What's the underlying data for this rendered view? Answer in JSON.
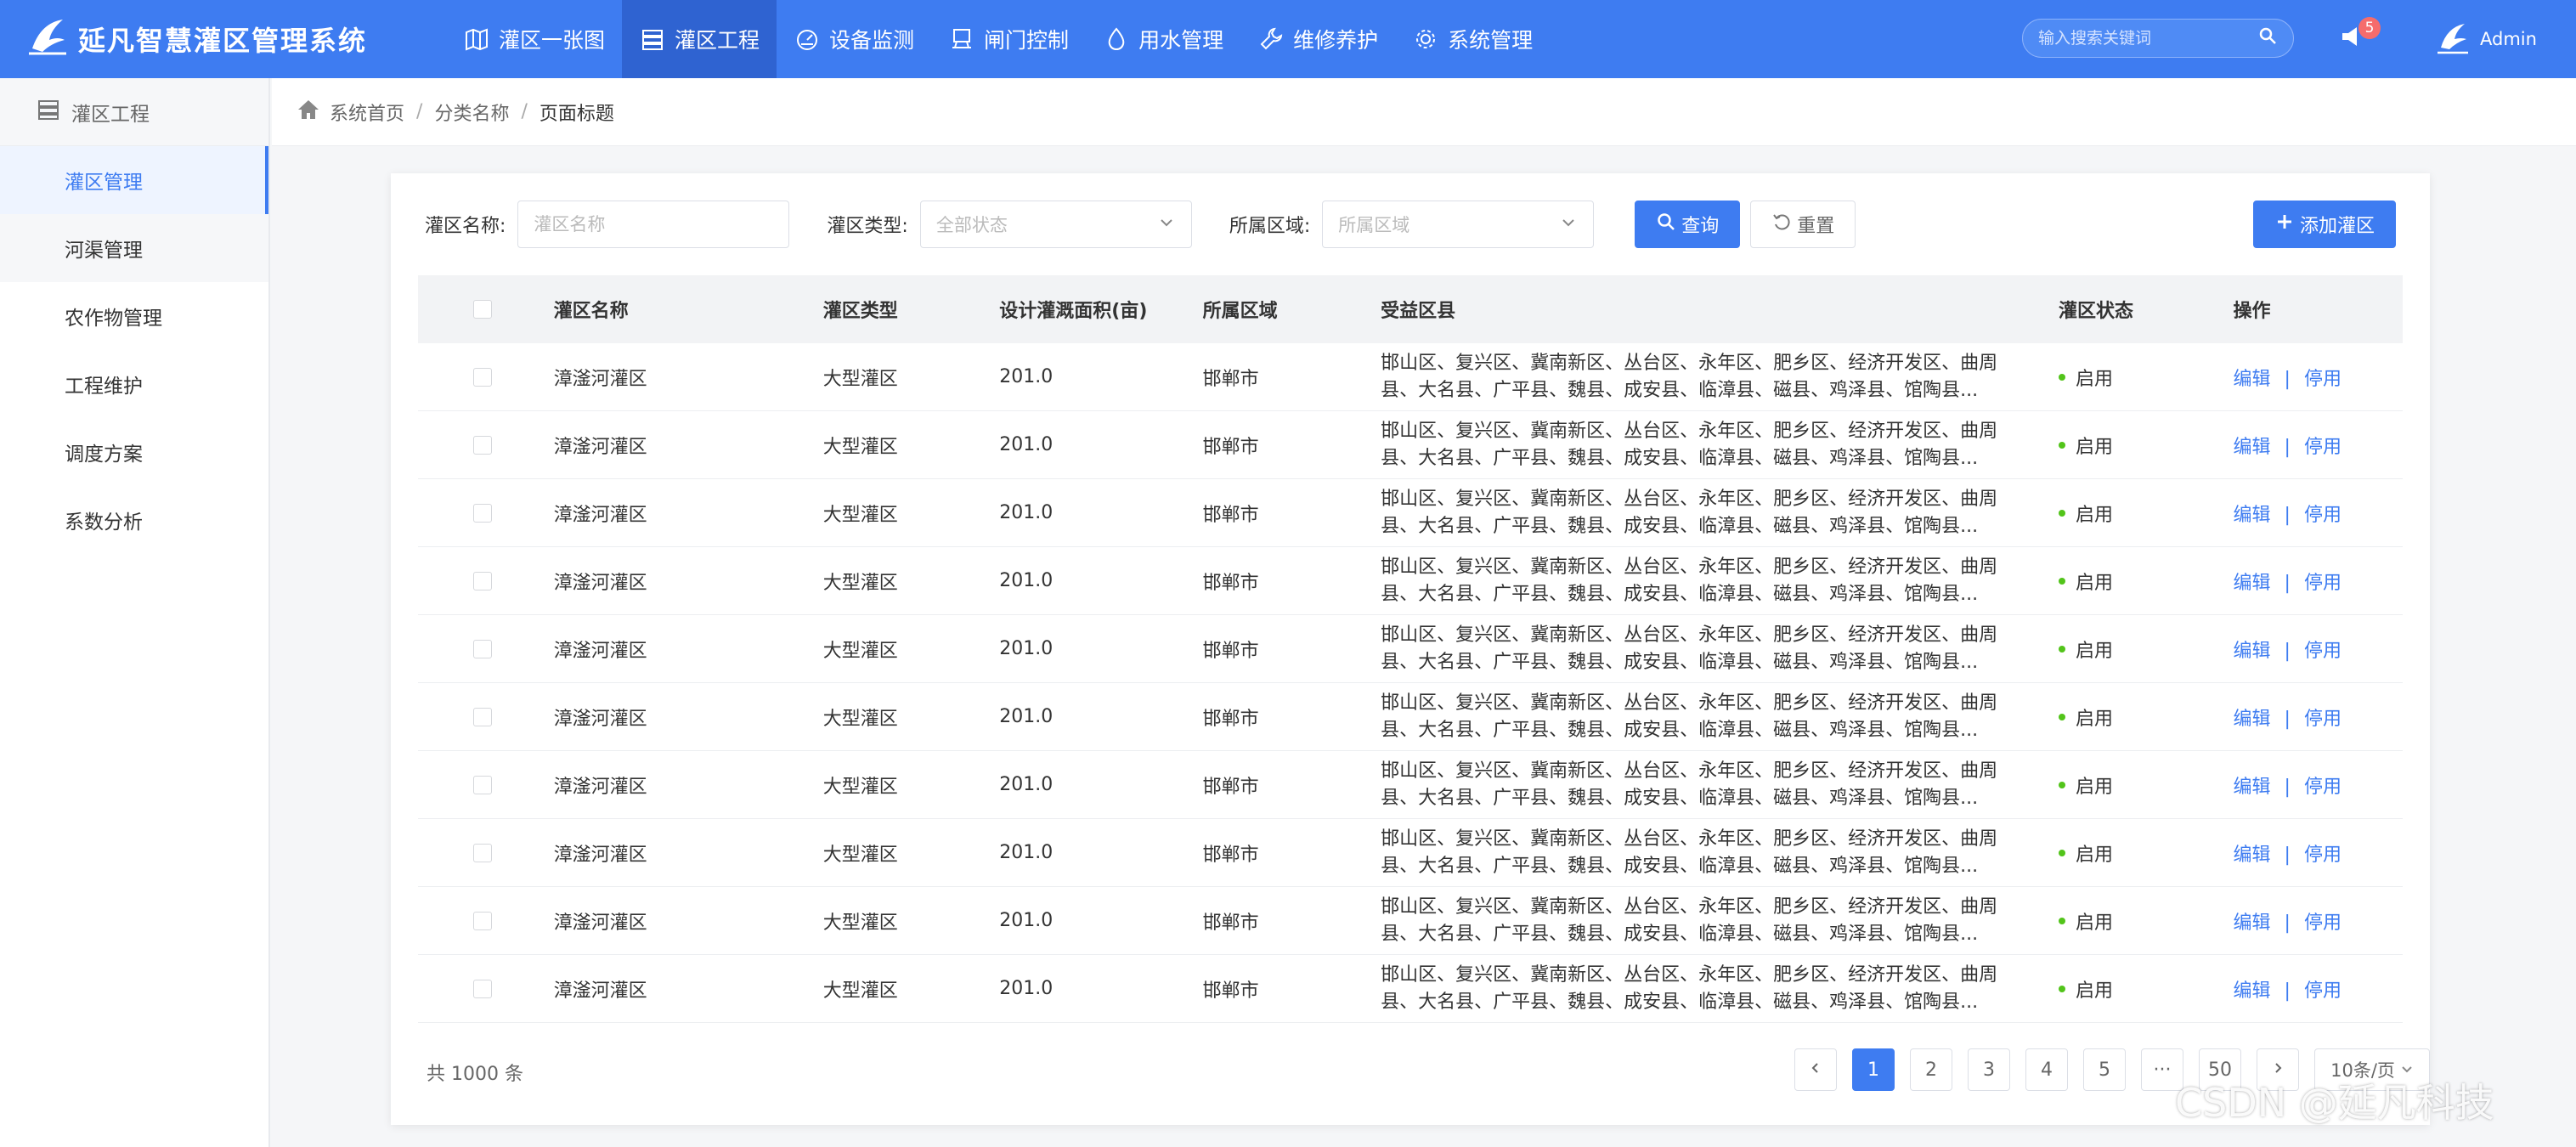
{
  "app": {
    "title": "延凡智慧灌区管理系统"
  },
  "nav": [
    {
      "label": "灌区一张图",
      "icon": "map-icon"
    },
    {
      "label": "灌区工程",
      "icon": "server-icon"
    },
    {
      "label": "设备监测",
      "icon": "monitor-icon"
    },
    {
      "label": "闸门控制",
      "icon": "gate-icon"
    },
    {
      "label": "用水管理",
      "icon": "water-drop-icon"
    },
    {
      "label": "维修养护",
      "icon": "wrench-icon"
    },
    {
      "label": "系统管理",
      "icon": "gear-icon"
    }
  ],
  "nav_active_index": 1,
  "header": {
    "search_placeholder": "输入搜索关键词",
    "notification_count": "5",
    "user_name": "Admin"
  },
  "sidebar": {
    "section": "灌区工程",
    "items": [
      {
        "label": "灌区管理",
        "active": true
      },
      {
        "label": "河渠管理",
        "active": false
      },
      {
        "label": "农作物管理",
        "active": false
      },
      {
        "label": "工程维护",
        "active": false
      },
      {
        "label": "调度方案",
        "active": false
      },
      {
        "label": "系数分析",
        "active": false
      }
    ]
  },
  "breadcrumb": [
    "系统首页",
    "分类名称",
    "页面标题"
  ],
  "filters": {
    "name_label": "灌区名称:",
    "name_placeholder": "灌区名称",
    "type_label": "灌区类型:",
    "type_placeholder": "全部状态",
    "region_label": "所属区域:",
    "region_placeholder": "所属区域",
    "query_button": "查询",
    "reset_button": "重置",
    "add_button": "添加灌区"
  },
  "table": {
    "columns": [
      "灌区名称",
      "灌区类型",
      "设计灌溉面积(亩)",
      "所属区域",
      "受益区县",
      "灌区状态",
      "操作"
    ],
    "edit_label": "编辑",
    "disable_label": "停用",
    "rows": [
      {
        "name": "漳滏河灌区",
        "type": "大型灌区",
        "area": "201.0",
        "region": "邯郸市",
        "counties": "邯山区、复兴区、冀南新区、丛台区、永年区、肥乡区、经济开发区、曲周县、大名县、广平县、魏县、成安县、临漳县、磁县、鸡泽县、馆陶县...",
        "status": "启用"
      },
      {
        "name": "漳滏河灌区",
        "type": "大型灌区",
        "area": "201.0",
        "region": "邯郸市",
        "counties": "邯山区、复兴区、冀南新区、丛台区、永年区、肥乡区、经济开发区、曲周县、大名县、广平县、魏县、成安县、临漳县、磁县、鸡泽县、馆陶县...",
        "status": "启用"
      },
      {
        "name": "漳滏河灌区",
        "type": "大型灌区",
        "area": "201.0",
        "region": "邯郸市",
        "counties": "邯山区、复兴区、冀南新区、丛台区、永年区、肥乡区、经济开发区、曲周县、大名县、广平县、魏县、成安县、临漳县、磁县、鸡泽县、馆陶县...",
        "status": "启用"
      },
      {
        "name": "漳滏河灌区",
        "type": "大型灌区",
        "area": "201.0",
        "region": "邯郸市",
        "counties": "邯山区、复兴区、冀南新区、丛台区、永年区、肥乡区、经济开发区、曲周县、大名县、广平县、魏县、成安县、临漳县、磁县、鸡泽县、馆陶县...",
        "status": "启用"
      },
      {
        "name": "漳滏河灌区",
        "type": "大型灌区",
        "area": "201.0",
        "region": "邯郸市",
        "counties": "邯山区、复兴区、冀南新区、丛台区、永年区、肥乡区、经济开发区、曲周县、大名县、广平县、魏县、成安县、临漳县、磁县、鸡泽县、馆陶县...",
        "status": "启用"
      },
      {
        "name": "漳滏河灌区",
        "type": "大型灌区",
        "area": "201.0",
        "region": "邯郸市",
        "counties": "邯山区、复兴区、冀南新区、丛台区、永年区、肥乡区、经济开发区、曲周县、大名县、广平县、魏县、成安县、临漳县、磁县、鸡泽县、馆陶县...",
        "status": "启用"
      },
      {
        "name": "漳滏河灌区",
        "type": "大型灌区",
        "area": "201.0",
        "region": "邯郸市",
        "counties": "邯山区、复兴区、冀南新区、丛台区、永年区、肥乡区、经济开发区、曲周县、大名县、广平县、魏县、成安县、临漳县、磁县、鸡泽县、馆陶县...",
        "status": "启用"
      },
      {
        "name": "漳滏河灌区",
        "type": "大型灌区",
        "area": "201.0",
        "region": "邯郸市",
        "counties": "邯山区、复兴区、冀南新区、丛台区、永年区、肥乡区、经济开发区、曲周县、大名县、广平县、魏县、成安县、临漳县、磁县、鸡泽县、馆陶县...",
        "status": "启用"
      },
      {
        "name": "漳滏河灌区",
        "type": "大型灌区",
        "area": "201.0",
        "region": "邯郸市",
        "counties": "邯山区、复兴区、冀南新区、丛台区、永年区、肥乡区、经济开发区、曲周县、大名县、广平县、魏县、成安县、临漳县、磁县、鸡泽县、馆陶县...",
        "status": "启用"
      },
      {
        "name": "漳滏河灌区",
        "type": "大型灌区",
        "area": "201.0",
        "region": "邯郸市",
        "counties": "邯山区、复兴区、冀南新区、丛台区、永年区、肥乡区、经济开发区、曲周县、大名县、广平县、魏县、成安县、临漳县、磁县、鸡泽县、馆陶县...",
        "status": "启用"
      }
    ]
  },
  "pagination": {
    "total_text": "共 1000 条",
    "pages": [
      "1",
      "2",
      "3",
      "4",
      "5",
      "···",
      "50"
    ],
    "current": "1",
    "page_size": "10条/页"
  },
  "watermark": "CSDN @延凡科技",
  "colors": {
    "primary": "#3e7cf1",
    "status_ok": "#52c41a",
    "badge": "#f56c6c"
  }
}
